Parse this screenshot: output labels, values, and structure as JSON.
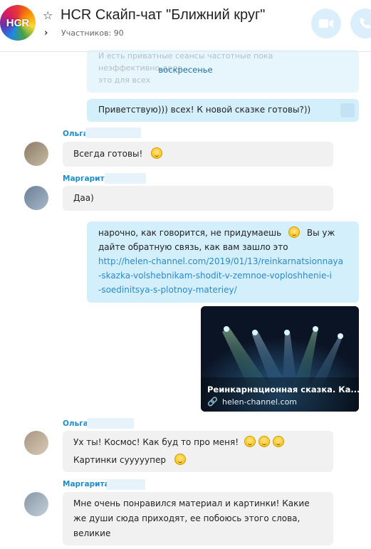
{
  "header": {
    "logo_text": "HCR",
    "title": "HCR Скайп-чат \"Ближний круг\"",
    "participants": "Участников: 90"
  },
  "day_separator": "воскресенье",
  "top_faded_lines": [
    "И есть приватные сеансы частотные пока",
    "неэффективно деле",
    "это для всех"
  ],
  "messages": {
    "greet_out": "Приветствую))) всех! К новой сказке готовы?))",
    "olga1_sender": "Ольга",
    "olga1_text": "Всегда готовы!",
    "margarita1_sender": "Маргарита",
    "margarita1_text": "Даа)",
    "out2_line1": "нарочно, как говорится, не придумаешь",
    "out2_line1b": "Вы уж",
    "out2_line2": "дайте обратную связь, как вам зашло это",
    "out2_link1": "http://helen-channel.com/2019/01/13/reinkarnatsionnaya",
    "out2_link2": "-skazka-volshebnikam-shodit-v-zemnoe-voploshhenie-i",
    "out2_link3": "-soedinitsya-s-plotnoy-materiey/",
    "card_title": "Реинкарнационная сказка. Ка...",
    "card_domain": "helen-channel.com",
    "olga2_sender": "Ольга",
    "olga2_line1": "Ух ты! Космос! Как буд то про меня!",
    "olga2_line2": "Картинки сууууупер",
    "margarita2_sender": "Маргарита",
    "margarita2_line1": "Мне очень понравился материал и картинки! Какие",
    "margarita2_line2": "же души сюда приходят, ее побоюсь этого слова,",
    "margarita2_line3": "великие"
  },
  "colors": {
    "accent": "#1b8ec9",
    "outgoing_bubble": "#d4effc",
    "incoming_bubble": "#f1f1f1"
  }
}
